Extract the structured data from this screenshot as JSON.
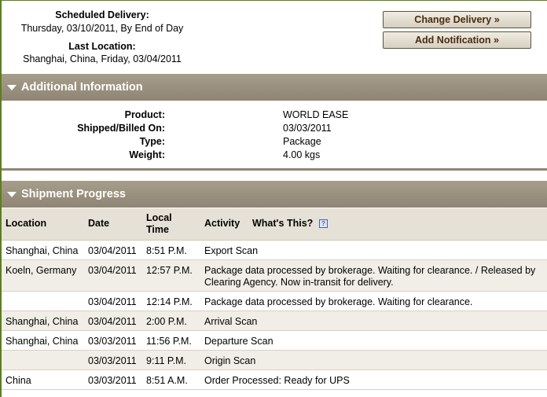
{
  "summary": {
    "scheduled_label": "Scheduled Delivery:",
    "scheduled_value": "Thursday, 03/10/2011, By End of Day",
    "last_location_label": "Last Location:",
    "last_location_value": "Shanghai, China, Friday, 03/04/2011"
  },
  "buttons": {
    "change_delivery": "Change Delivery »",
    "add_notification": "Add Notification »"
  },
  "additional_info": {
    "title": "Additional Information",
    "rows": [
      {
        "label": "Product:",
        "value": "WORLD EASE"
      },
      {
        "label": "Shipped/Billed On:",
        "value": "03/03/2011"
      },
      {
        "label": "Type:",
        "value": "Package"
      },
      {
        "label": "Weight:",
        "value": "4.00 kgs"
      }
    ]
  },
  "progress": {
    "title": "Shipment Progress",
    "headers": {
      "location": "Location",
      "date": "Date",
      "time_line1": "Local",
      "time_line2": "Time",
      "activity": "Activity",
      "whats_this": "What's This?",
      "help": "?"
    },
    "rows": [
      {
        "location": "Shanghai, China",
        "date": "03/04/2011",
        "time": "8:51 P.M.",
        "activity": "Export Scan"
      },
      {
        "location": "Koeln, Germany",
        "date": "03/04/2011",
        "time": "12:57 P.M.",
        "activity": "Package data processed by brokerage. Waiting for clearance. / Released by Clearing Agency. Now in-transit for delivery."
      },
      {
        "location": "",
        "date": "03/04/2011",
        "time": "12:14 P.M.",
        "activity": "Package data processed by brokerage. Waiting for clearance."
      },
      {
        "location": "Shanghai, China",
        "date": "03/04/2011",
        "time": "2:00 P.M.",
        "activity": "Arrival Scan"
      },
      {
        "location": "Shanghai, China",
        "date": "03/03/2011",
        "time": "11:56 P.M.",
        "activity": "Departure Scan"
      },
      {
        "location": "",
        "date": "03/03/2011",
        "time": "9:11 P.M.",
        "activity": "Origin Scan"
      },
      {
        "location": "China",
        "date": "03/03/2011",
        "time": "8:51 A.M.",
        "activity": "Order Processed: Ready for UPS"
      }
    ]
  },
  "colors": {
    "section_bar": "#978d7c",
    "border_green": "#5a7f1e",
    "alt_row": "#f1eee7",
    "button_text": "#4a2a12"
  }
}
